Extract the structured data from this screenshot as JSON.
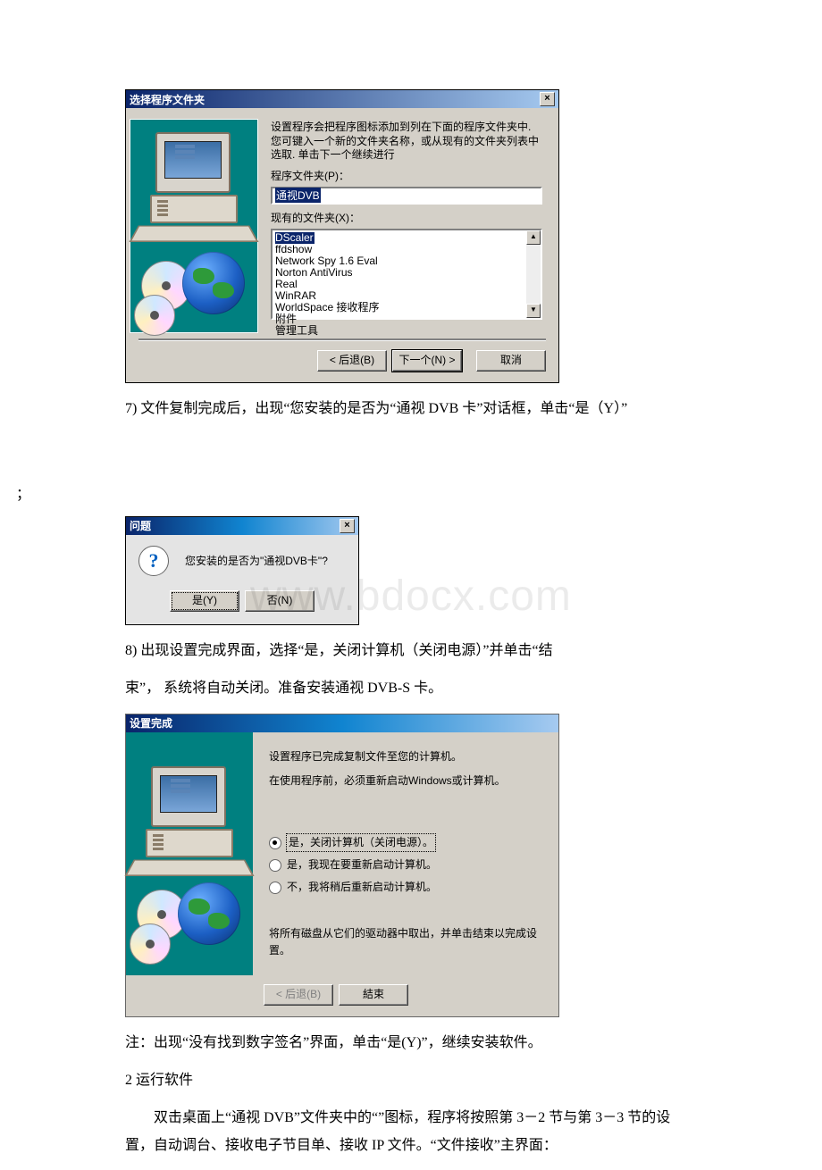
{
  "dialog1": {
    "title": "选择程序文件夹",
    "desc": "设置程序会把程序图标添加到列在下面的程序文件夹中. 您可键入一个新的文件夹名称，或从现有的文件夹列表中选取. 单击下一个继续进行",
    "folder_label": "程序文件夹(P)：",
    "folder_value": "通视DVB",
    "existing_label": "现有的文件夹(X)：",
    "items": [
      "DScaler",
      "ffdshow",
      "Network Spy 1.6 Eval",
      "Norton AntiVirus",
      "Real",
      "WinRAR",
      "WorldSpace 接收程序",
      "附件",
      "管理工具"
    ],
    "btn_back": "< 后退(B)",
    "btn_next": "下一个(N) >",
    "btn_cancel": "取消"
  },
  "para7": "7) 文件复制完成后，出现“您安装的是否为“通视 DVB 卡”对话框，单击“是（Y）”",
  "semicolon": "；",
  "dialog2": {
    "title": "问题",
    "msg": "您安装的是否为\"通视DVB卡\"?",
    "btn_yes": "是(Y)",
    "btn_no": "否(N)"
  },
  "para8a": "8) 出现设置完成界面，选择“是，关闭计算机（关闭电源）”并单击“结",
  "para8b": "束”， 系统将自动关闭。准备安装通视 DVB-S 卡。",
  "dialog3": {
    "title": "设置完成",
    "msg1": "设置程序已完成复制文件至您的计算机。",
    "msg2": "在使用程序前，必须重新启动Windows或计算机。",
    "opt1": "是，关闭计算机（关闭电源）。",
    "opt2": "是，我现在要重新启动计算机。",
    "opt3": "不，我将稍后重新启动计算机。",
    "msg3": "将所有磁盘从它们的驱动器中取出，并单击结束以完成设置。",
    "btn_back": "< 后退(B)",
    "btn_finish": "結束"
  },
  "note": "注：出现“没有找到数字签名”界面，单击“是(Y)”，继续安装软件。",
  "sec2": "2 运行软件",
  "run_para": "双击桌面上“通视 DVB”文件夹中的“”图标，程序将按照第 3－2 节与第 3－3 节的设置，自动调台、接收电子节目单、接收 IP 文件。“文件接收”主界面：",
  "watermark": "www.bdocx.com"
}
